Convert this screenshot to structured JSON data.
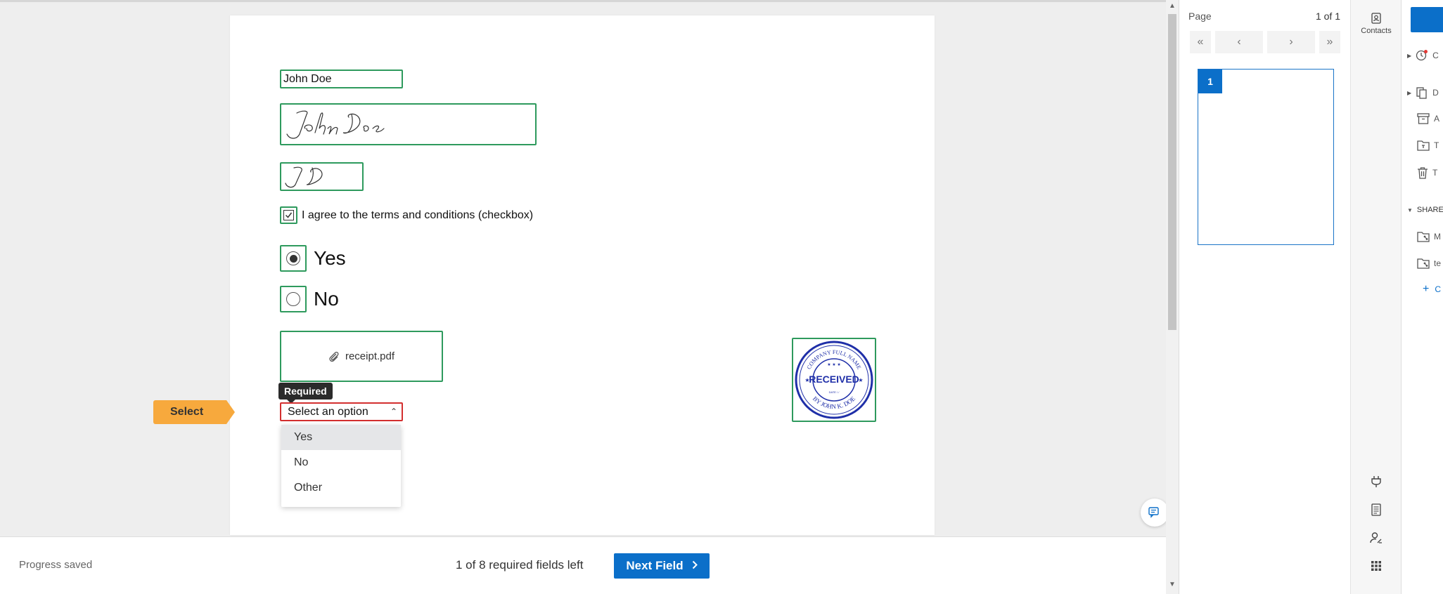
{
  "document": {
    "name_value": "John Doe",
    "checkbox_label": "I agree to the terms and conditions (checkbox)",
    "radio_options": [
      "Yes",
      "No"
    ],
    "radio_selected": "Yes",
    "attachment_name": "receipt.pdf",
    "stamp_text": {
      "top": "COMPANY FULL NAME",
      "center": "RECEIVED",
      "date": "DATE  /  /",
      "bottom": "BY JOHN K. DOE"
    },
    "required_tooltip": "Required",
    "select_placeholder": "Select an option",
    "dropdown_options": [
      "Yes",
      "No",
      "Other"
    ],
    "dropdown_highlighted": "Yes",
    "field_marker": "Select"
  },
  "bottom_bar": {
    "status": "Progress saved",
    "fields_left": "1 of 8 required fields left",
    "next_label": "Next Field"
  },
  "page_panel": {
    "label": "Page",
    "count": "1 of 1",
    "thumbnail_number": "1"
  },
  "rail": {
    "contacts_label": "Contacts"
  },
  "far_panel": {
    "rows": [
      "C",
      "D",
      "A",
      "T",
      "T"
    ],
    "shared_label": "SHARE",
    "shared_rows": [
      "M",
      "te",
      "C"
    ]
  },
  "colors": {
    "accent": "#0b6fc9",
    "field_border": "#2e9a5d",
    "required_border": "#d32f2f",
    "marker": "#f7a93d",
    "stamp": "#1f2fa8"
  }
}
